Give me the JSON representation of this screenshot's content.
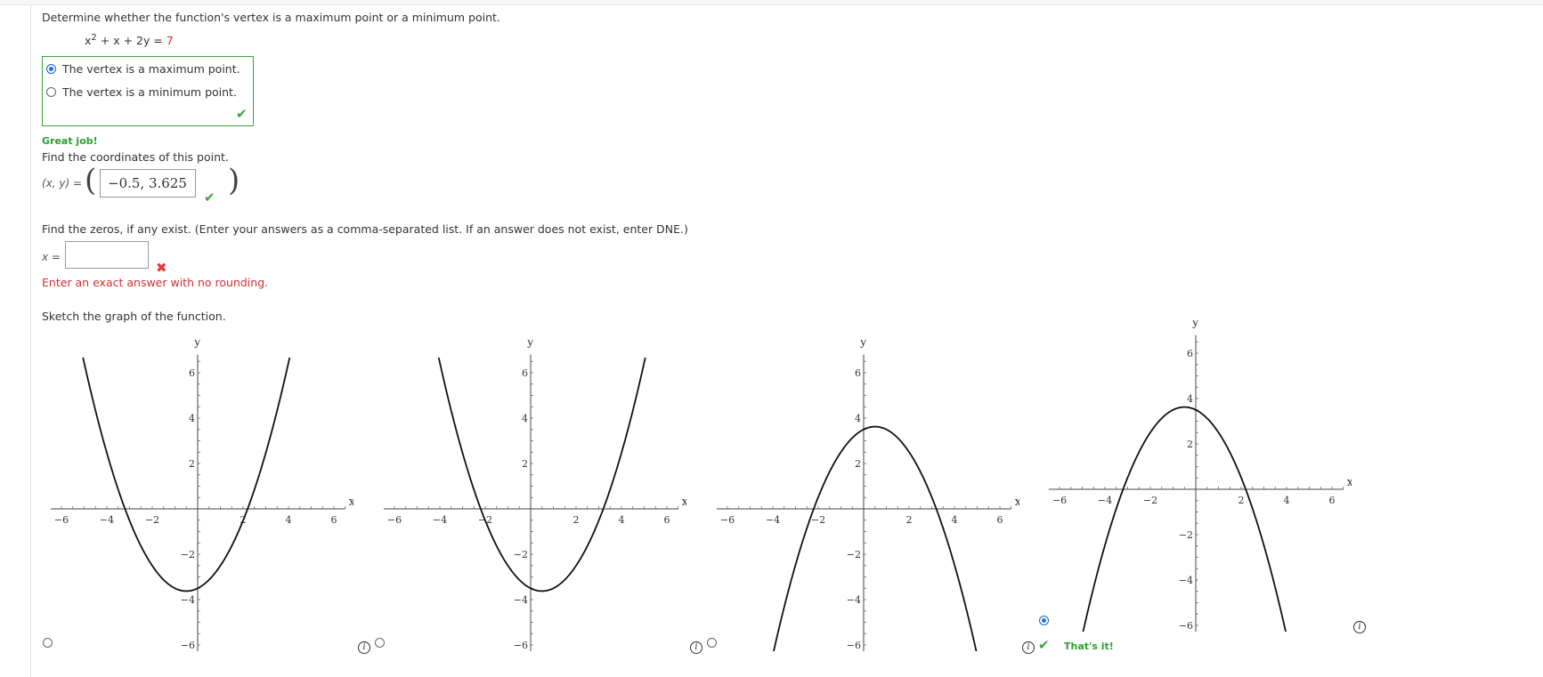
{
  "q1": {
    "prompt": "Determine whether the function's vertex is a maximum point or a minimum point.",
    "equation": {
      "lhs_base": "x",
      "lhs_exp": "2",
      "lhs_rest": " + x + 2y = ",
      "rhs": "7"
    },
    "options": [
      {
        "label": "The vertex is a maximum point.",
        "selected": true
      },
      {
        "label": "The vertex is a minimum point.",
        "selected": false
      }
    ],
    "feedback": "Great job!"
  },
  "q2": {
    "prompt": "Find the coordinates of this point.",
    "label": "(x, y) =",
    "value": "−0.5, 3.625"
  },
  "q3": {
    "prompt": "Find the zeros, if any exist. (Enter your answers as a comma-separated list. If an answer does not exist, enter DNE.)",
    "label": "x =",
    "value": "",
    "error": "Enter an exact answer with no rounding."
  },
  "q4": {
    "prompt": "Sketch the graph of the function.",
    "feedback": "That's it!",
    "selected_index": 3
  },
  "graphs": [
    {
      "shape": "upward parabola",
      "vertex": [
        -0.5,
        -3.625
      ],
      "zeros": [
        -3.2,
        2.2
      ]
    },
    {
      "shape": "upward parabola",
      "vertex": [
        0.5,
        -3.625
      ],
      "zeros": [
        -2.2,
        3.2
      ]
    },
    {
      "shape": "downward parabola",
      "vertex": [
        0.5,
        3.625
      ],
      "zeros": [
        -2.2,
        3.2
      ]
    },
    {
      "shape": "downward parabola",
      "vertex": [
        -0.5,
        3.625
      ],
      "zeros": [
        -3.2,
        2.2
      ]
    }
  ],
  "axes": {
    "x_label": "x",
    "y_label": "y",
    "x_ticks": [
      "−6",
      "−4",
      "−2",
      "2",
      "4",
      "6"
    ],
    "y_ticks": [
      "6",
      "4",
      "2",
      "−2",
      "−4",
      "−6"
    ]
  },
  "colors": {
    "correct": "#3aa33a",
    "error": "#d32f2f",
    "selected": "#1a73e8"
  }
}
